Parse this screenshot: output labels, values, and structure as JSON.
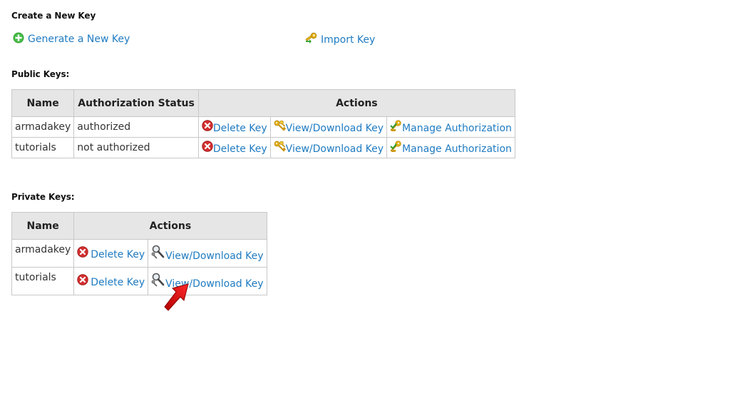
{
  "create_section": {
    "title": "Create a New Key",
    "generate_label": "Generate a New Key",
    "import_label": "Import Key"
  },
  "public_keys": {
    "title": "Public Keys:",
    "headers": [
      "Name",
      "Authorization Status",
      "Actions"
    ],
    "rows": [
      {
        "name": "armadakey",
        "status": "authorized",
        "delete_label": "Delete Key",
        "view_label": "View/Download Key",
        "manage_label": "Manage Authorization"
      },
      {
        "name": "tutorials",
        "status": "not authorized",
        "delete_label": "Delete Key",
        "view_label": "View/Download Key",
        "manage_label": "Manage Authorization"
      }
    ]
  },
  "private_keys": {
    "title": "Private Keys:",
    "headers": [
      "Name",
      "Actions"
    ],
    "rows": [
      {
        "name": "armadakey",
        "delete_label": "Delete Key",
        "view_label": "View/Download Key"
      },
      {
        "name": "tutorials",
        "delete_label": "Delete Key",
        "view_label": "View/Download Key"
      }
    ]
  },
  "icons": {
    "generate": "plus-circle-icon",
    "import": "key-import-icon",
    "delete": "delete-x-icon",
    "view_public": "keys-icon",
    "manage": "key-check-icon",
    "view_private": "magnifier-key-icon",
    "annotation": "red-arrow-icon"
  },
  "colors": {
    "link": "#1f7bc1",
    "header_bg": "#e6e6e6",
    "border": "#c8c8c8",
    "plus_green": "#3aa83a",
    "delete_red": "#d32f2f",
    "key_gold": "#e5b217",
    "annotation_red": "#e01010"
  }
}
